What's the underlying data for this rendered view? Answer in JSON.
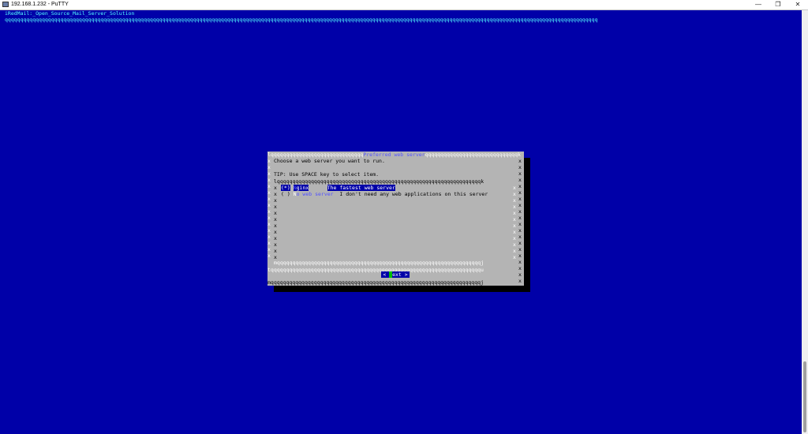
{
  "window": {
    "title": "192.168.1.232 - PuTTY",
    "minimize_glyph": "—",
    "maximize_glyph": "❐",
    "close_glyph": "✕"
  },
  "terminal": {
    "backtitle": "iRedMail:_Open_Source_Mail_Server_Solution",
    "top_rule": "qqqqqqqqqqqqqqqqqqqqqqqqqqqqqqqqqqqqqqqqqqqqqqqqqqqqqqqqqqqqqqqqqqqqqqqqqqqqqqqqqqqqqqqqqqqqqqqqqqqqqqqqqqqqqqqqqqqqqqqqqqqqqqqqqqqqqqqqqqqqqqqqqqqqqqqqqqqqqqqqqqqqqqqqqqqqqqqqqqqqqqqqqqqqqqqq"
  },
  "dialog": {
    "top_border_left": "lqqqqqqqqqqqqqqqqqqqqqqqqqqqqqq",
    "title": "Preferred web server",
    "top_border_right": "qqqqqqqqqqqqqqqqqqqqqqqqqqqqqqk",
    "prompt": "Choose a web server you want to run.",
    "tip": "TIP: Use SPACE key to select item.",
    "list_top_border": "lqqqqqqqqqqqqqqqqqqqqqqqqqqqqqqqqqqqqqqqqqqqqqqqqqqqqqqqqqqqqqqqqqqk",
    "list_bottom_border": "mqqqqqqqqqqqqqqqqqqqqqqqqqqqqqqqqqqqqqqqqqqqqqqqqqqqqqqqqqqqqqqqqqqj",
    "separator": "tqqqqqqqqqqqqqqqqqqqqqqqqqqqqqqqqqqqqqqqqqqqqqqqqqqqqqqqqqqqqqqqqqqqqu",
    "bottom_border": "mqqqqqqqqqqqqqqqqqqqqqqqqqqqqqqqqqqqqqqqqqqqqqqqqqqqqqqqqqqqqqqqqqqqqj",
    "side_char": "x",
    "options": [
      {
        "mark": "(*)",
        "name": "Nginx",
        "name_visible": "ginx",
        "hotkey": "N",
        "description": "The fastest web server"
      },
      {
        "mark": "( )",
        "name": "No web server",
        "name_visible": "o web server",
        "hotkey": "N",
        "description": "I don't need any web applications on this server"
      }
    ],
    "button_left": "<",
    "button_label_rest": "ext",
    "button_hotkey": "N",
    "button_right": ">"
  }
}
